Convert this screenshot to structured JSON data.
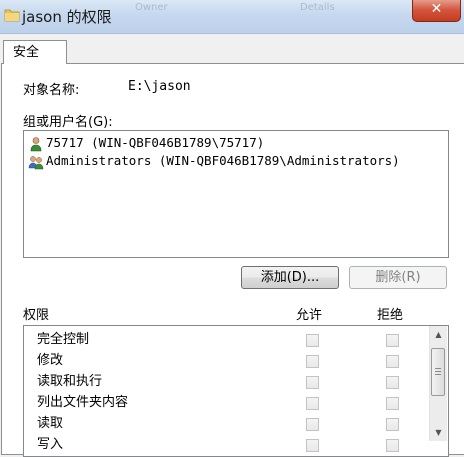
{
  "window": {
    "title": "jason 的权限",
    "close_label": "✕",
    "faint_left": "Owner",
    "faint_right": "Details"
  },
  "tabs": [
    {
      "label": "安全"
    }
  ],
  "object": {
    "label": "对象名称:",
    "value": "E:\\jason"
  },
  "users": {
    "label": "组或用户名(G):",
    "items": [
      {
        "name": "75717 (WIN-QBF046B1789\\75717)",
        "icon": "user-icon"
      },
      {
        "name": "Administrators (WIN-QBF046B1789\\Administrators)",
        "icon": "group-icon"
      }
    ],
    "add_label": "添加(D)...",
    "remove_label": "删除(R)"
  },
  "permissions": {
    "label": "权限",
    "allow_label": "允许",
    "deny_label": "拒绝",
    "items": [
      {
        "name": "完全控制",
        "allow": false,
        "deny": false
      },
      {
        "name": "修改",
        "allow": false,
        "deny": false
      },
      {
        "name": "读取和执行",
        "allow": false,
        "deny": false
      },
      {
        "name": "列出文件夹内容",
        "allow": false,
        "deny": false
      },
      {
        "name": "读取",
        "allow": false,
        "deny": false
      },
      {
        "name": "写入",
        "allow": false,
        "deny": false
      }
    ]
  }
}
